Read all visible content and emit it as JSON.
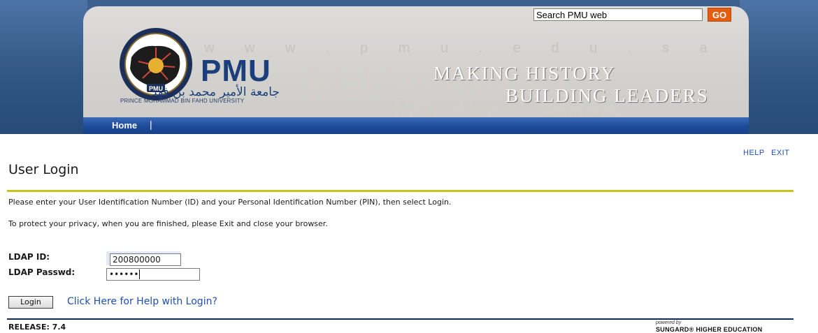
{
  "header": {
    "watermark_url": "w w w . p m u . e d u . s a",
    "watermark_text_1": "Making History",
    "watermark_text_2": "Building Leaders",
    "brand": "PMU",
    "arabic_name": "جامعة الأمير محمد بن فهد",
    "english_name": "PRINCE MOHAMMAD BIN FAHD UNIVERSITY",
    "seal_label": "PMU",
    "slogan_line1": "MAKING HISTORY",
    "slogan_line2": "BUILDING LEADERS",
    "search": {
      "value": "Search PMU web",
      "button_label": "GO"
    },
    "nav": {
      "home_label": "Home",
      "separator": "|"
    },
    "colors": {
      "nav_blue": "#1f4d9c",
      "go_orange": "#e55e10",
      "brand_navy": "#1b3f7a"
    }
  },
  "top_links": {
    "help": "HELP",
    "exit": "EXIT"
  },
  "page": {
    "title": "User Login",
    "instruction": "Please enter your User Identification Number (ID) and your Personal Identification Number (PIN), then select Login.",
    "privacy_note": "To protect your privacy, when you are finished, please Exit and close your browser."
  },
  "form": {
    "ldap_id_label": "LDAP ID:",
    "ldap_id_value": "200800000",
    "password_label": "LDAP Passwd:",
    "password_value": "••••••",
    "login_button": "Login",
    "help_link": "Click Here for Help with Login?"
  },
  "footer": {
    "release": "RELEASE: 7.4",
    "powered_by": "powered by",
    "vendor": "SUNGARD® HIGHER EDUCATION"
  }
}
